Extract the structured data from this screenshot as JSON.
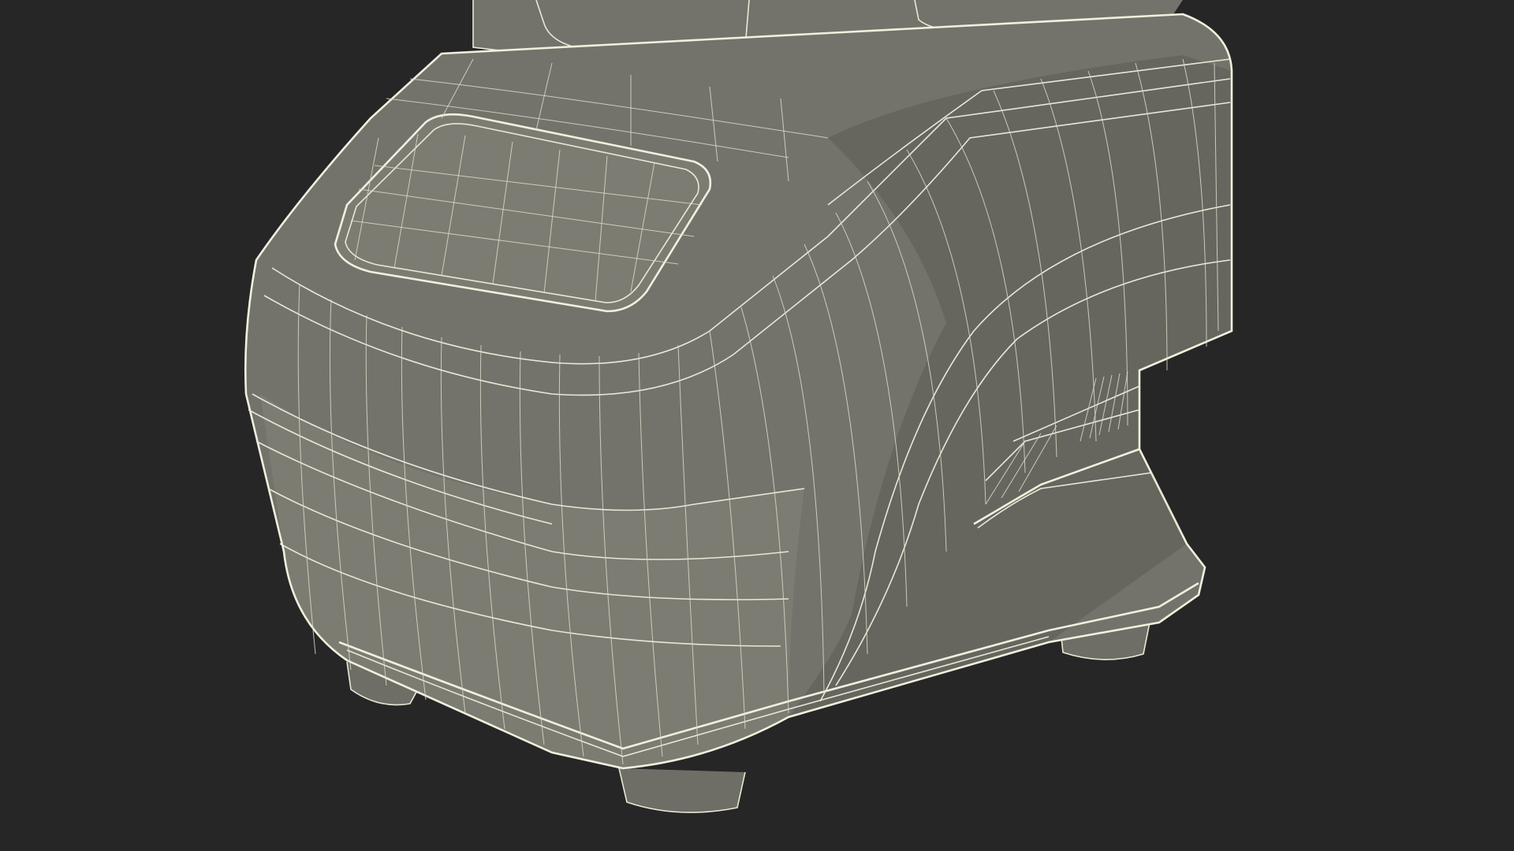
{
  "scene": {
    "subject": "blender-base-wireframe",
    "colors": {
      "background": "#262626",
      "surface": "#73736b",
      "wire": "#e9e8d6"
    }
  }
}
